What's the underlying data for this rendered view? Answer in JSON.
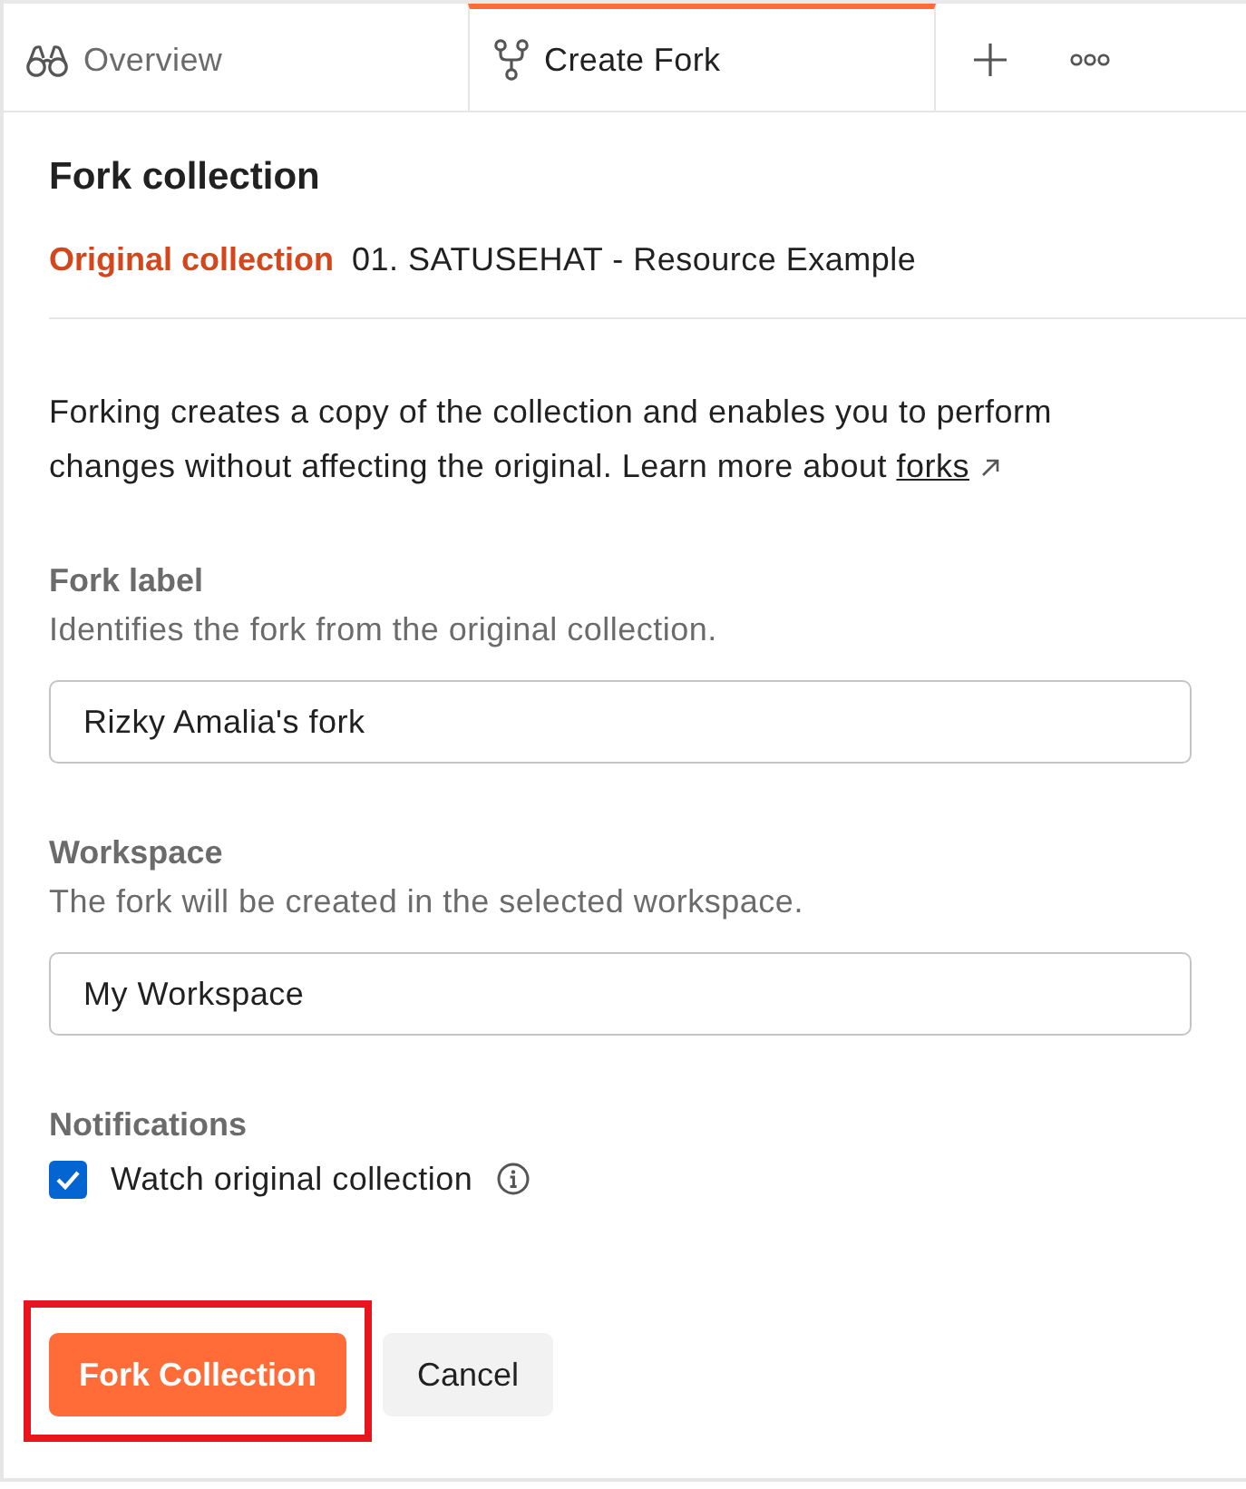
{
  "tabs": [
    {
      "label": "Overview",
      "selected": false
    },
    {
      "label": "Create Fork",
      "selected": true
    }
  ],
  "panel": {
    "title": "Fork collection",
    "original": {
      "label": "Original collection",
      "value": "01. SATUSEHAT - Resource Example"
    },
    "description": {
      "text": "Forking creates a copy of the collection and enables you to perform changes without affecting the original. Learn more about",
      "link": "forks"
    },
    "fields": [
      {
        "label": "Fork label",
        "hint": "Identifies the fork from the original collection.",
        "value": "Rizky Amalia's fork"
      },
      {
        "label": "Workspace",
        "hint": "The fork will be created in the selected workspace.",
        "value": "My Workspace"
      }
    ],
    "notifications": {
      "label": "Notifications",
      "option": {
        "label": "Watch original collection",
        "checked": true
      }
    },
    "buttons": [
      {
        "label": "Fork Collection",
        "kind": "primary",
        "highlighted": true
      },
      {
        "label": "Cancel",
        "kind": "secondary",
        "highlighted": false
      }
    ]
  }
}
